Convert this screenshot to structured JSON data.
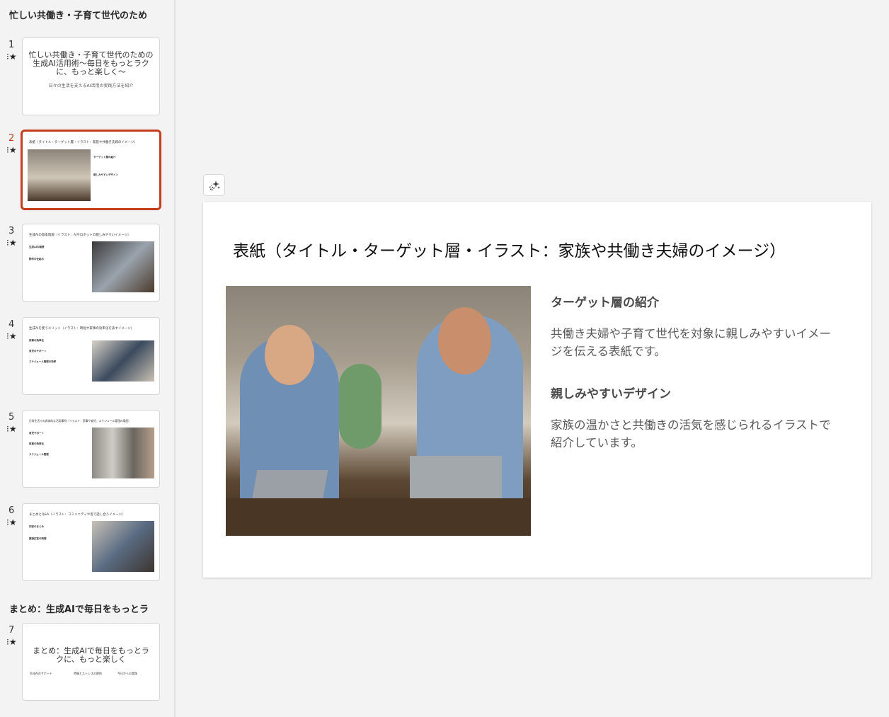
{
  "sidebar": {
    "sections": [
      "忙しい共働き・子育て世代のため",
      "まとめ：生成AIで毎日をもっとラ"
    ],
    "slides": [
      {
        "number": "1",
        "title": "忙しい共働き・子育て世代のための生成AI活用術〜毎日をもっとラクに、もっと楽しく〜",
        "subtitle": "日々の生活を支えるAI活用の実践方法を紹介"
      },
      {
        "number": "2",
        "title": "表紙（タイトル・ターゲット層・イラスト：家族や共働き夫婦のイメージ）",
        "items": [
          "ターゲット層の紹介",
          "親しみやすいデザイン"
        ]
      },
      {
        "number": "3",
        "title": "生成AIの基本情報（イラスト：AIやロボットの親しみやすいイメージ）",
        "items": [
          "生成AIの概要",
          "動作の仕組み"
        ]
      },
      {
        "number": "4",
        "title": "生成AIを使うメリット（イラスト：時短や家事の効率化を表すイメージ）",
        "items": [
          "家事の効率化",
          "育児のサポート",
          "スケジュール管理の効率"
        ]
      },
      {
        "number": "5",
        "title": "日常生活での具体的な活用事例（イラスト：家事や育児、スケジュール管理の場面）",
        "items": [
          "育児サポート",
          "家事の効率化",
          "スケジュール管理"
        ]
      },
      {
        "number": "6",
        "title": "まとめとQ&A（イラスト：コミュニティや皆で話し合うイメージ）",
        "items": [
          "内容のまとめ",
          "質疑応答の時間"
        ]
      },
      {
        "number": "7",
        "title": "まとめ：生成AIで毎日をもっとラクに、もっと楽しく",
        "items": [
          "生成AIのサポート",
          "時間とストレスの節約",
          "今日からの実践"
        ]
      }
    ]
  },
  "main": {
    "title": "表紙（タイトル・ターゲット層・イラスト：家族や共働き夫婦のイメージ）",
    "heading1": "ターゲット層の紹介",
    "body1": "共働き夫婦や子育て世代を対象に親しみやすいイメージを伝える表紙です。",
    "heading2": "親しみやすいデザイン",
    "body2": "家族の温かさと共働きの活気を感じられるイラストで紹介しています。"
  },
  "colors": {
    "selected": "#c43e1c",
    "background": "#f3f3f3"
  }
}
